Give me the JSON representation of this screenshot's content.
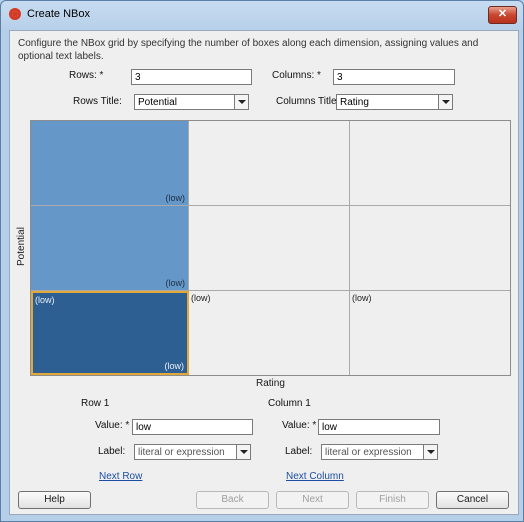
{
  "window": {
    "title": "Create NBox",
    "close_glyph": "✕"
  },
  "description": "Configure the NBox grid by specifying the number of boxes along each dimension, assigning values and optional text labels.",
  "rows_label": "Rows: *",
  "rows_value": "3",
  "columns_label": "Columns: *",
  "columns_value": "3",
  "rows_title_label": "Rows Title:",
  "rows_title_value": "Potential",
  "columns_title_label": "Columns Title:",
  "columns_title_value": "Rating",
  "grid": {
    "y_axis_label": "Potential",
    "x_axis_label": "Rating",
    "cells": {
      "r1c1": "(low)",
      "r2c1": "(low)",
      "r3c1_top": "(low)",
      "r3c1_bottom": "(low)",
      "r3c2": "(low)",
      "r3c3": "(low)"
    }
  },
  "row_panel": {
    "heading": "Row 1",
    "value_label": "Value: *",
    "value": "low",
    "label_label": "Label:",
    "label_placeholder": "literal or expression",
    "next_link": "Next Row"
  },
  "column_panel": {
    "heading": "Column 1",
    "value_label": "Value: *",
    "value": "low",
    "label_label": "Label:",
    "label_placeholder": "literal or expression",
    "next_link": "Next Column"
  },
  "buttons": {
    "help": "Help",
    "back": "Back",
    "next": "Next",
    "finish": "Finish",
    "cancel": "Cancel"
  }
}
